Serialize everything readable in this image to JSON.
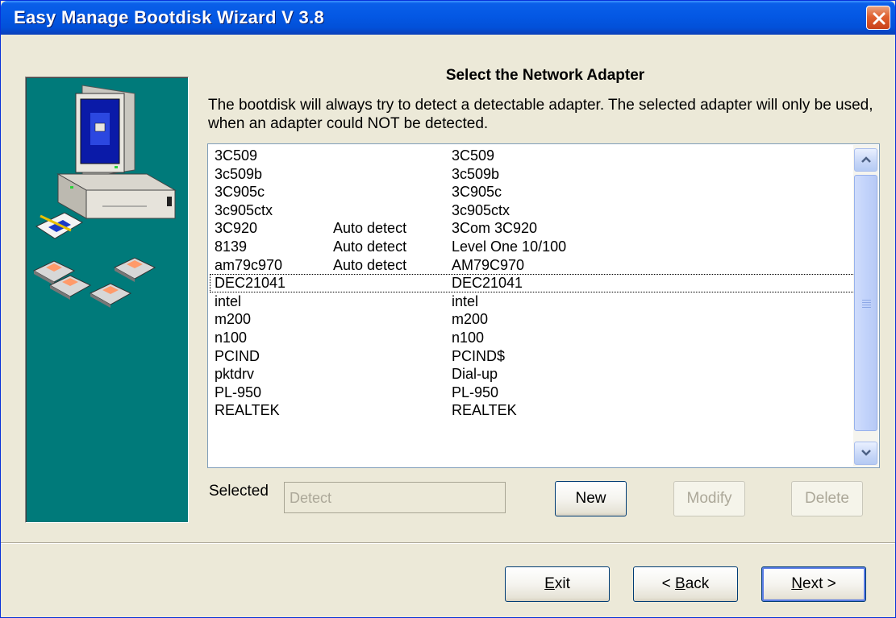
{
  "window": {
    "title": "Easy Manage Bootdisk Wizard V 3.8"
  },
  "page": {
    "heading": "Select the Network Adapter",
    "description": "The bootdisk will always try to detect a detectable adapter. The selected adapter will only be used, when an adapter could NOT be detected."
  },
  "adapters": [
    {
      "name": "3C509",
      "detect": "",
      "description": "3C509"
    },
    {
      "name": "3c509b",
      "detect": "",
      "description": "3c509b"
    },
    {
      "name": "3C905c",
      "detect": "",
      "description": "3C905c"
    },
    {
      "name": "3c905ctx",
      "detect": "",
      "description": "3c905ctx"
    },
    {
      "name": "3C920",
      "detect": "Auto detect",
      "description": "3Com 3C920"
    },
    {
      "name": "8139",
      "detect": "Auto detect",
      "description": "Level One 10/100"
    },
    {
      "name": "am79c970",
      "detect": "Auto detect",
      "description": "AM79C970"
    },
    {
      "name": "DEC21041",
      "detect": "",
      "description": "DEC21041"
    },
    {
      "name": "intel",
      "detect": "",
      "description": "intel"
    },
    {
      "name": "m200",
      "detect": "",
      "description": "m200"
    },
    {
      "name": "n100",
      "detect": "",
      "description": "n100"
    },
    {
      "name": "PCIND",
      "detect": "",
      "description": "PCIND$"
    },
    {
      "name": "pktdrv",
      "detect": "",
      "description": "Dial-up"
    },
    {
      "name": "PL-950",
      "detect": "",
      "description": "PL-950"
    },
    {
      "name": "REALTEK",
      "detect": "",
      "description": "REALTEK"
    }
  ],
  "focused_adapter": "DEC21041",
  "selected": {
    "label": "Selected",
    "value": "Detect"
  },
  "actions": {
    "new": "New",
    "modify": "Modify",
    "delete": "Delete"
  },
  "nav": {
    "exit": {
      "key": "E",
      "rest": "xit"
    },
    "back": {
      "prefix": "< ",
      "key": "B",
      "rest": "ack"
    },
    "next": {
      "key": "N",
      "rest": "ext >"
    }
  },
  "colors": {
    "title_bar": "#0458e4",
    "art_panel": "#007a7a",
    "face": "#ece9d8"
  },
  "icons": [
    "close-icon",
    "scroll-up-icon",
    "scroll-down-icon",
    "computer-icon",
    "floppy-disk-icon",
    "document-icon"
  ]
}
